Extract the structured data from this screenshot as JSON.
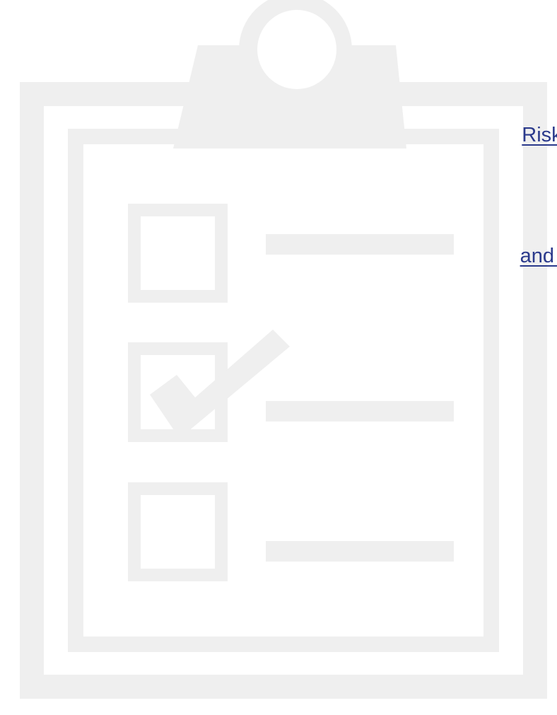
{
  "links": {
    "risk_management": "Risk Management",
    "operational": "and Operational"
  },
  "illustration": {
    "icon": "clipboard-checklist-icon",
    "color": "#efefef"
  },
  "colors": {
    "link": "#2b3a8c",
    "background": "#ffffff"
  }
}
